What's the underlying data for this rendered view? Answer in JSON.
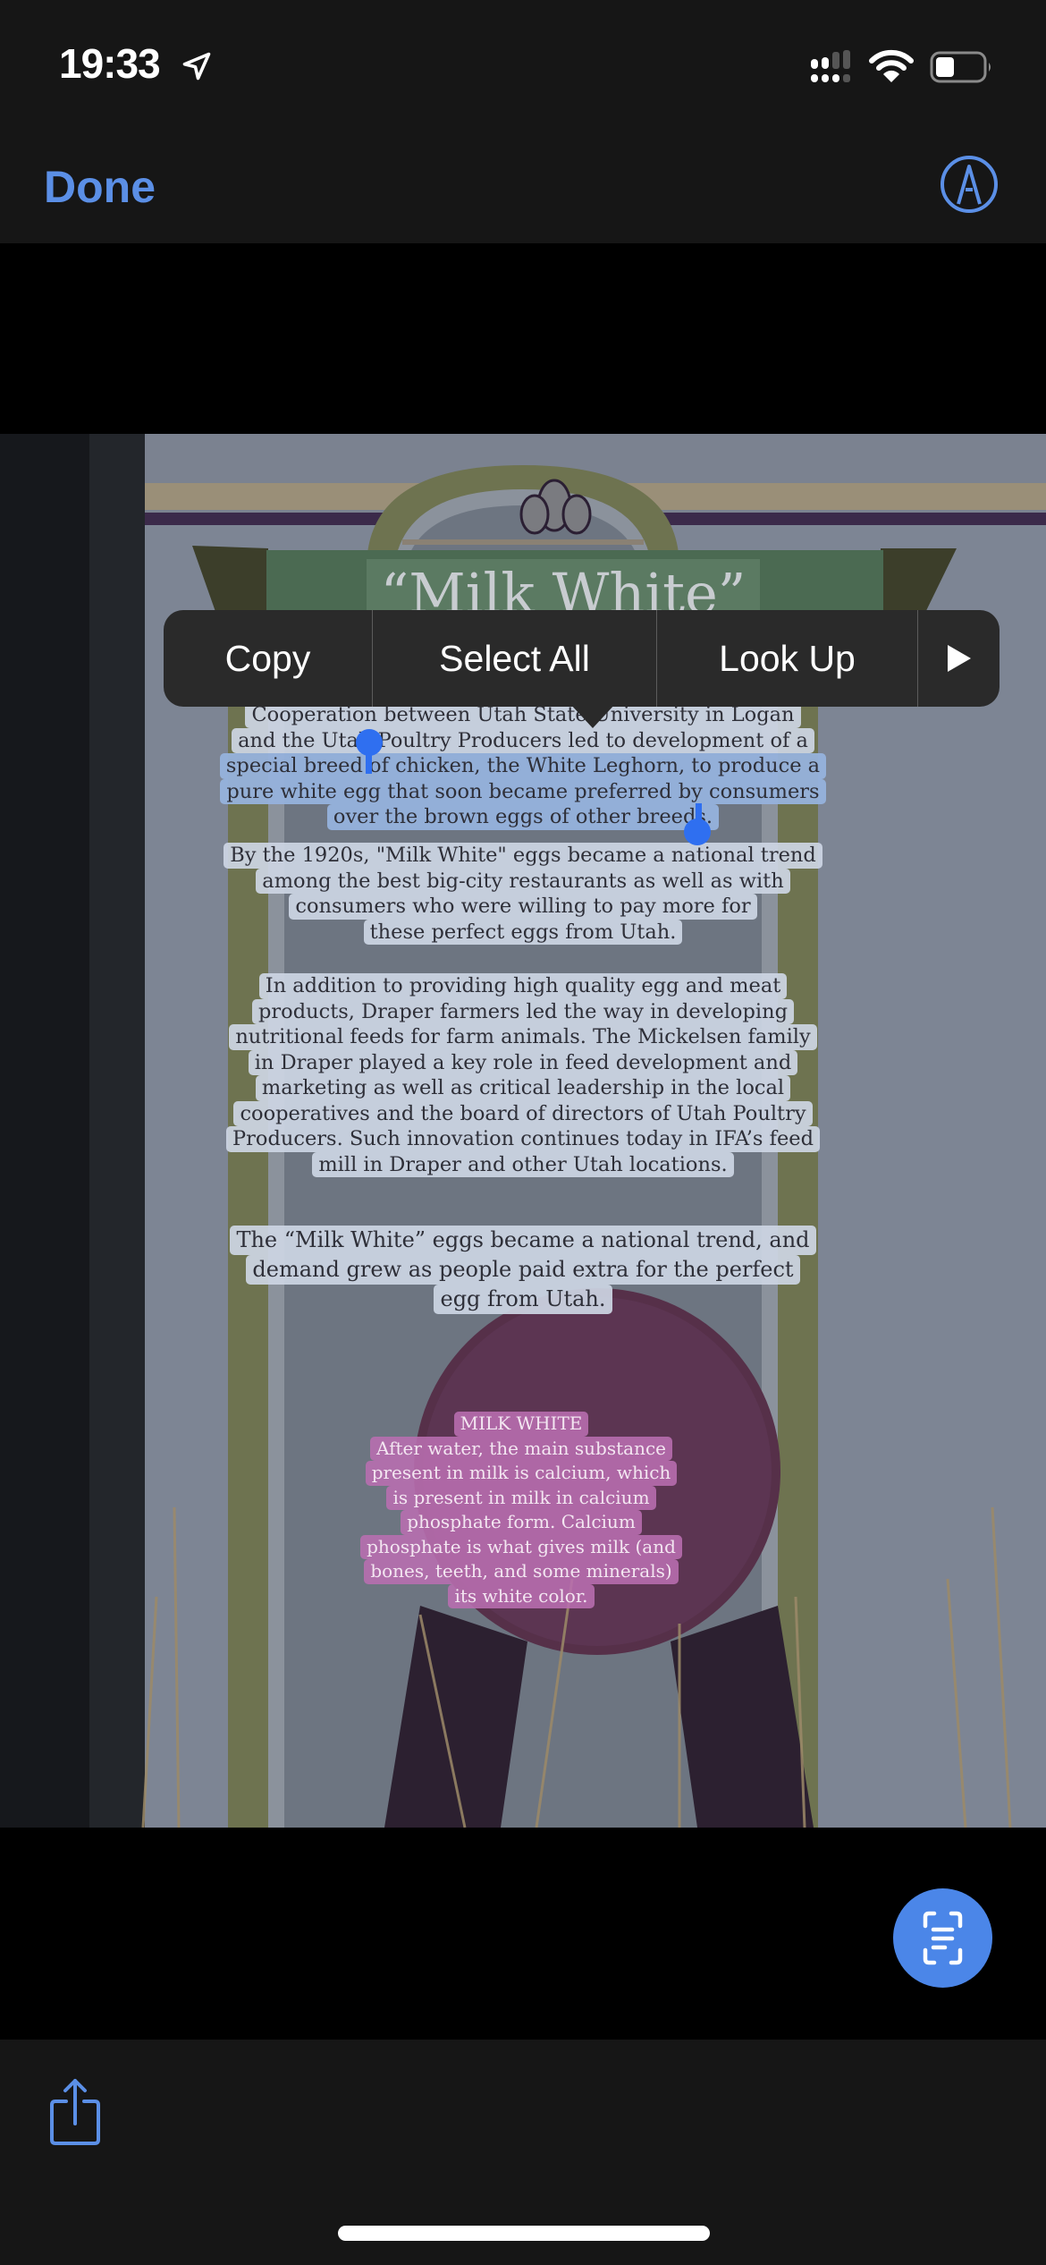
{
  "status_bar": {
    "time": "19:33",
    "location_icon": "location-arrow-icon",
    "signal_icon": "cellular-signal-icon",
    "wifi_icon": "wifi-icon",
    "battery_icon": "battery-icon",
    "battery_level": 0.3
  },
  "nav": {
    "done_label": "Done",
    "markup_icon": "markup-pen-icon"
  },
  "context_menu": {
    "items": [
      {
        "label": "Copy"
      },
      {
        "label": "Select All"
      },
      {
        "label": "Look Up"
      },
      {
        "label": "▶",
        "icon": "more-arrow-icon"
      }
    ]
  },
  "photo": {
    "sign_title": "“Milk White”",
    "paragraphs": [
      {
        "lines": [
          "Cooperation between Utah State University in Logan",
          "and the Utah Poultry Producers led to development of a",
          "special breed of chicken, the White Leghorn, to produce a",
          "pure white egg that soon became preferred by consumers",
          "over the brown eggs of other breeds."
        ],
        "selected_text": "breed of chicken, the White Leghorn, to produce a pure white egg that soon became preferred by consumers over the brown eggs of other"
      },
      {
        "lines": [
          "By the 1920s, \"Milk White\" eggs became a national trend",
          "among the best big-city restaurants as well as with",
          "consumers who were willing to pay more for",
          "these perfect eggs from Utah."
        ]
      },
      {
        "lines": [
          "In addition to providing high quality egg and meat",
          "products, Draper farmers led the way in developing",
          "nutritional feeds for farm animals. The Mickelsen family",
          "in Draper played a key role in feed development and",
          "marketing as well as critical leadership in the local",
          "cooperatives and the board of directors of Utah Poultry",
          "Producers.  Such innovation continues today in IFA’s feed",
          "mill in Draper and other Utah locations."
        ]
      },
      {
        "lines": [
          "The “Milk White” eggs became a national trend, and",
          "demand grew as people paid extra for the perfect",
          "egg from Utah."
        ]
      }
    ],
    "badge": {
      "title": "MILK WHITE",
      "lines": [
        "After water, the main substance",
        "present in milk is calcium, which",
        "is present in milk in calcium",
        "phosphate form. Calcium",
        "phosphate is what gives milk (and",
        "bones, teeth, and some minerals)",
        "its white color."
      ]
    }
  },
  "live_text_button": {
    "icon": "live-text-scan-icon"
  },
  "toolbar": {
    "share_icon": "share-icon"
  },
  "colors": {
    "accent": "#5b8fe6",
    "bar_bg": "#161616",
    "menu_bg": "#2a2a2a",
    "selection_handle": "#2f6ff0",
    "live_text_bg": "#4b86e8"
  }
}
